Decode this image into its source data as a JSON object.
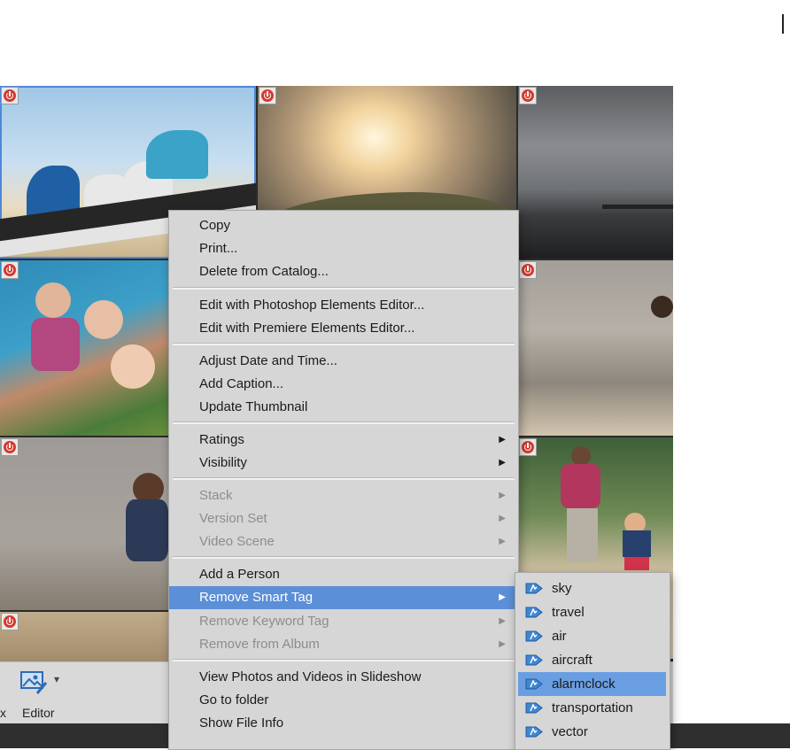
{
  "menu": {
    "items": [
      {
        "label": "Copy",
        "state": "enabled"
      },
      {
        "label": "Print...",
        "state": "enabled"
      },
      {
        "label": "Delete from Catalog...",
        "state": "enabled"
      },
      {
        "label": "Edit with Photoshop Elements Editor...",
        "state": "enabled"
      },
      {
        "label": "Edit with Premiere Elements Editor...",
        "state": "enabled"
      },
      {
        "label": "Adjust Date and Time...",
        "state": "enabled"
      },
      {
        "label": "Add Caption...",
        "state": "enabled"
      },
      {
        "label": "Update Thumbnail",
        "state": "enabled"
      },
      {
        "label": "Ratings",
        "state": "enabled",
        "submenu": true
      },
      {
        "label": "Visibility",
        "state": "enabled",
        "submenu": true
      },
      {
        "label": "Stack",
        "state": "disabled",
        "submenu": true
      },
      {
        "label": "Version Set",
        "state": "disabled",
        "submenu": true
      },
      {
        "label": "Video Scene",
        "state": "disabled",
        "submenu": true
      },
      {
        "label": "Add a Person",
        "state": "enabled"
      },
      {
        "label": "Remove Smart Tag",
        "state": "highlighted",
        "submenu": true
      },
      {
        "label": "Remove Keyword Tag",
        "state": "disabled",
        "submenu": true
      },
      {
        "label": "Remove from Album",
        "state": "disabled",
        "submenu": true
      },
      {
        "label": "View Photos and Videos in Slideshow",
        "state": "enabled"
      },
      {
        "label": "Go to folder",
        "state": "enabled"
      },
      {
        "label": "Show File Info",
        "state": "enabled"
      }
    ],
    "submenu_arrow": "▶"
  },
  "submenu": {
    "items": [
      {
        "label": "sky"
      },
      {
        "label": "travel"
      },
      {
        "label": "air"
      },
      {
        "label": "aircraft"
      },
      {
        "label": "alarmclock",
        "highlighted": true
      },
      {
        "label": "transportation"
      },
      {
        "label": "vector"
      }
    ],
    "icon": "smart-tag-icon"
  },
  "toolbar": {
    "partial_label": "x",
    "editor_label": "Editor",
    "editor_dropdown": "▾"
  },
  "colors": {
    "highlight": "#5b8fd8",
    "menu_bg": "#d6d6d6",
    "badge_red": "#d23a2f",
    "tag_blue": "#3f86d3"
  }
}
